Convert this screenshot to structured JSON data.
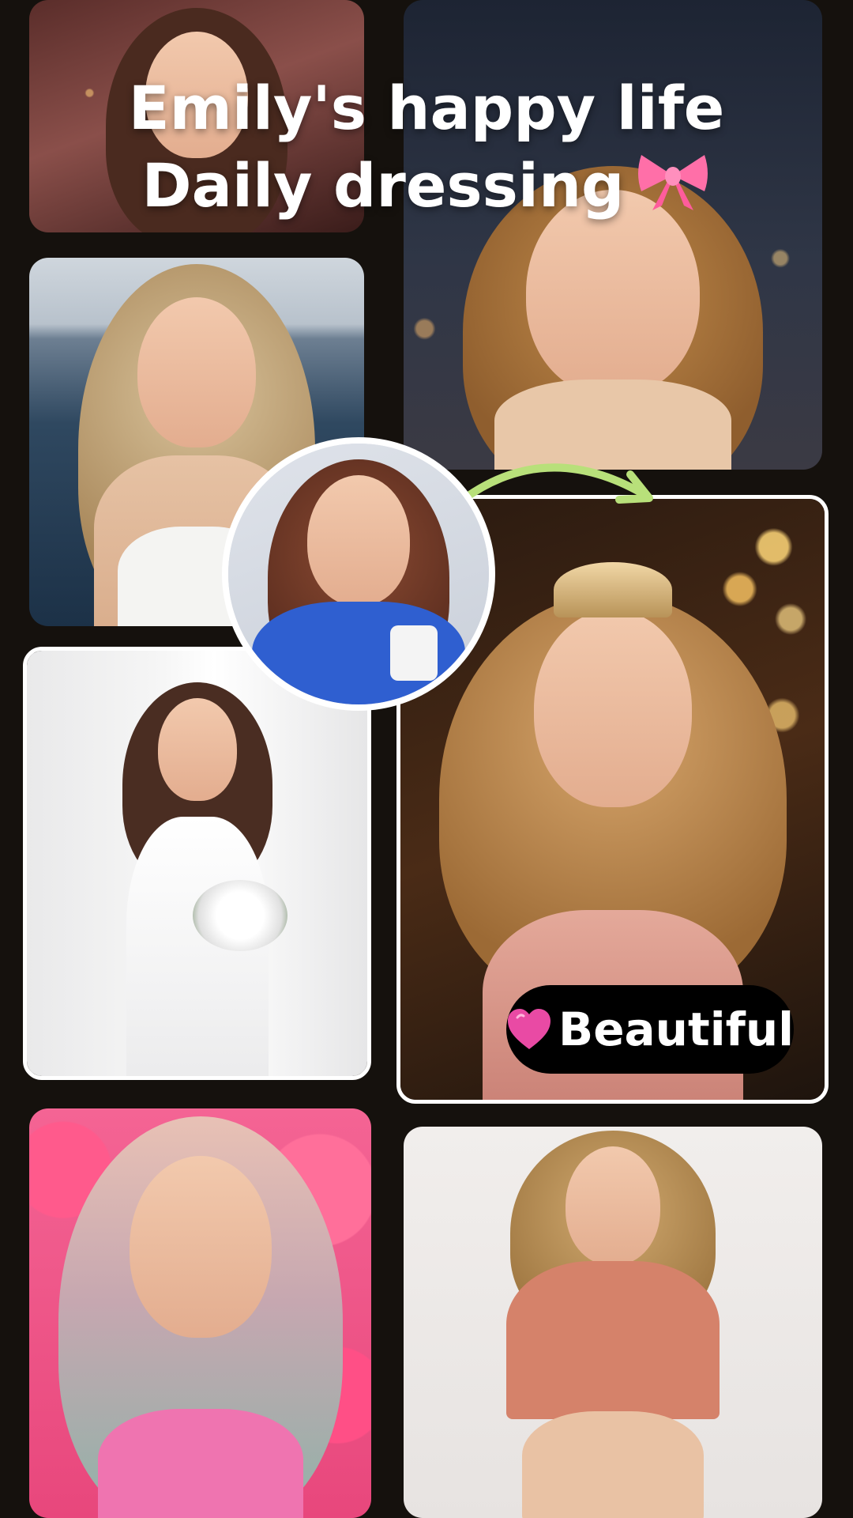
{
  "headline": {
    "line1": "Emily's happy life",
    "line2": "Daily dressing"
  },
  "badge": {
    "label": "Beautiful",
    "icon": "pink-heart-icon"
  },
  "decorations": {
    "bow_icon": "pink-bow-icon",
    "arrow_icon": "curved-arrow-icon",
    "arrow_color": "#b8e07a"
  },
  "colors": {
    "background": "#15110d",
    "frame": "#ffffff",
    "badge_bg": "#000000",
    "heart": "#e94aa4",
    "bow": "#ff6fa8"
  }
}
